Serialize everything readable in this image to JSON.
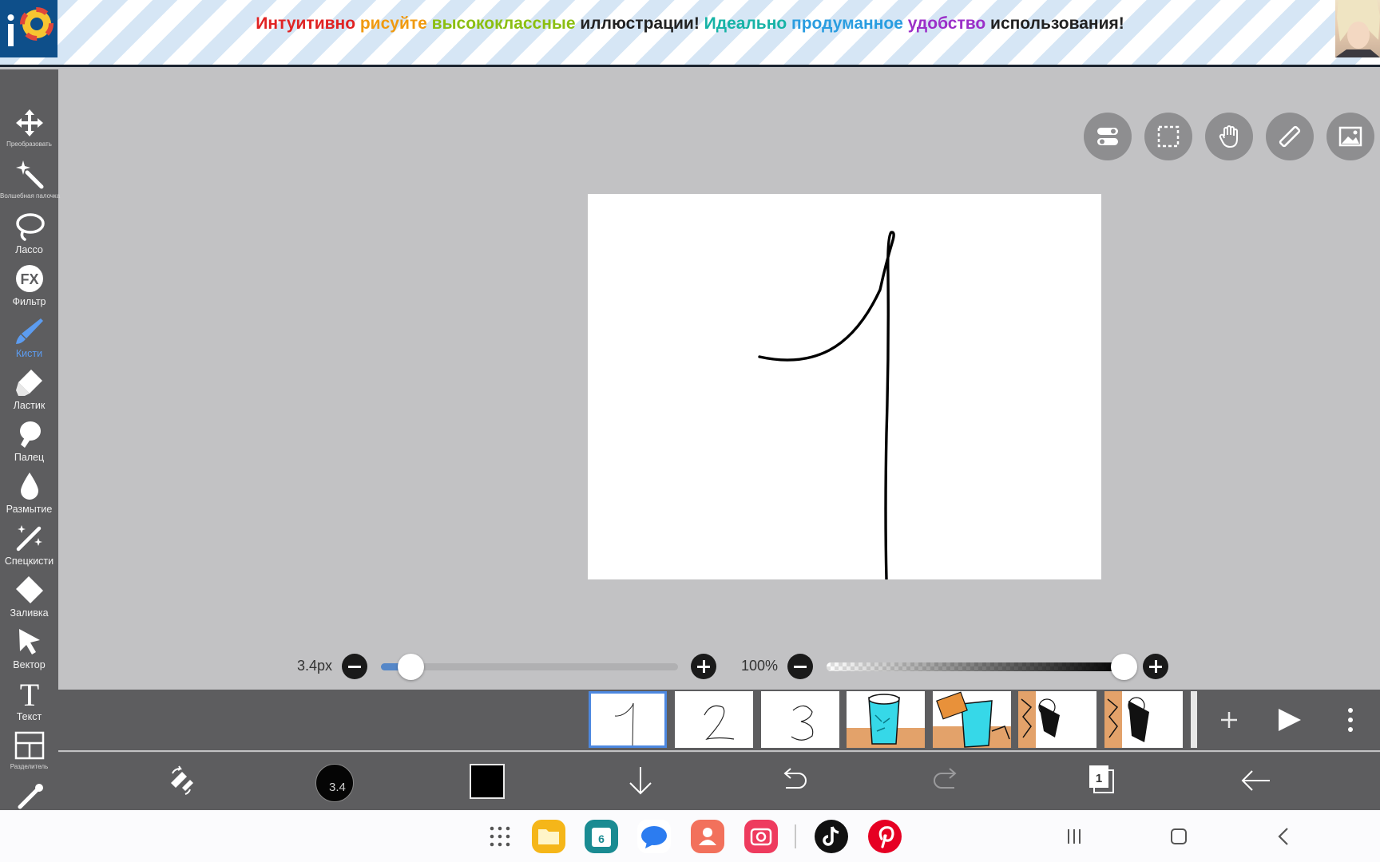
{
  "banner": {
    "segments": [
      {
        "text": "Интуитивно ",
        "color": "#e02323"
      },
      {
        "text": "рисуйте ",
        "color": "#f09a10"
      },
      {
        "text": "высококлассные ",
        "color": "#8bbf12"
      },
      {
        "text": "иллюстрации! ",
        "color": "#222222"
      },
      {
        "text": "Идеально ",
        "color": "#17b3a6"
      },
      {
        "text": "продуманное ",
        "color": "#2a9de0"
      },
      {
        "text": "удобство ",
        "color": "#9b2fc8"
      },
      {
        "text": "использования!",
        "color": "#222222"
      }
    ],
    "logo_text": "i"
  },
  "toolbar": {
    "tools": [
      {
        "label": "Преобразовать",
        "icon": "move-arrows-icon"
      },
      {
        "label": "Волшебная палочка",
        "icon": "magic-wand-icon"
      },
      {
        "label": "Лассо",
        "icon": "lasso-icon"
      },
      {
        "label": "Фильтр",
        "icon": "fx-icon"
      },
      {
        "label": "Кисти",
        "icon": "brush-icon"
      },
      {
        "label": "Ластик",
        "icon": "eraser-icon"
      },
      {
        "label": "Палец",
        "icon": "smudge-finger-icon"
      },
      {
        "label": "Размытие",
        "icon": "blur-drop-icon"
      },
      {
        "label": "Спецкисти",
        "icon": "special-brush-icon"
      },
      {
        "label": "Заливка",
        "icon": "fill-bucket-icon"
      },
      {
        "label": "Вектор",
        "icon": "vector-cursor-icon"
      },
      {
        "label": "Текст",
        "icon": "text-icon"
      },
      {
        "label": "Разделитель",
        "icon": "frame-divider-icon"
      },
      {
        "label": "",
        "icon": "eyedropper-icon"
      }
    ],
    "active_tool": "Кисти",
    "fx_text": "FX",
    "text_glyph": "T"
  },
  "sliders": {
    "brush_size_label": "3.4px",
    "brush_size_fraction": 0.1,
    "opacity_label": "100%",
    "opacity_fraction": 1.0
  },
  "frames": {
    "items": [
      {
        "name": "frame-1",
        "digit": "1"
      },
      {
        "name": "frame-2",
        "digit": "2"
      },
      {
        "name": "frame-3",
        "digit": "3"
      },
      {
        "name": "frame-4",
        "digit": ""
      },
      {
        "name": "frame-5",
        "digit": ""
      },
      {
        "name": "frame-6",
        "digit": ""
      },
      {
        "name": "frame-7",
        "digit": ""
      }
    ],
    "selected_index": 0
  },
  "bottombar": {
    "brush_size": "3.4",
    "color": "#000000",
    "layer_count": "1"
  },
  "colors": {
    "accent": "#4d88e0",
    "toolbar_bg": "#5d5d5f",
    "workspace_bg": "#c2c2c4"
  }
}
